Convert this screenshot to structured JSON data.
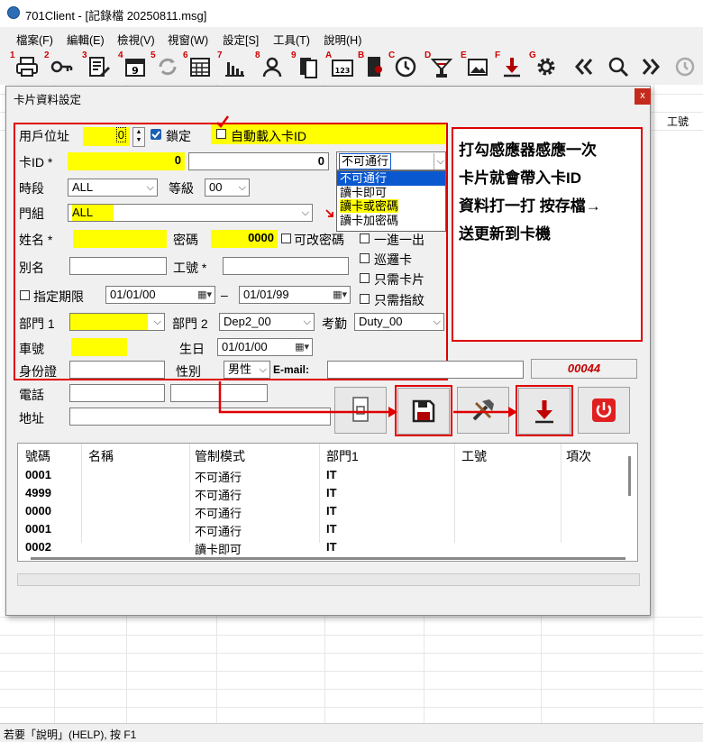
{
  "window": {
    "title": "701Client - [記錄檔 20250811.msg]"
  },
  "menu": [
    "檔案(F)",
    "編輯(E)",
    "檢視(V)",
    "視窗(W)",
    "設定[S]",
    "工具(T)",
    "說明(H)"
  ],
  "toolbar_numbers": [
    "1",
    "2",
    "3",
    "4",
    "5",
    "6",
    "7",
    "8",
    "9",
    "A",
    "B",
    "C",
    "D",
    "E",
    "F",
    "G"
  ],
  "toolbar_icon_text": {
    "calendar": "9",
    "contact_card": "123"
  },
  "background": {
    "column_header": "工號"
  },
  "dialog": {
    "title": "卡片資料設定",
    "close": "x",
    "user_address_label": "用戶位址",
    "user_address_value": "0",
    "lock_label": "鎖定",
    "auto_card_label": "自動載入卡ID",
    "card_id_label": "卡ID *",
    "card_id_value": "0",
    "card_id_value2": "0",
    "pass_mode_selected": "不可通行",
    "pass_mode_options": [
      "不可通行",
      "讀卡即可",
      "讀卡或密碼",
      "讀卡加密碼"
    ],
    "period_label": "時段",
    "period_value": "ALL",
    "level_label": "等級",
    "level_value": "00",
    "door_group_label": "門組",
    "door_group_value": "ALL",
    "name_label": "姓名 *",
    "password_label": "密碼",
    "password_value": "0000",
    "can_change_pw_label": "可改密碼",
    "one_in_one_out_label": "一進一出",
    "patrol_card_label": "巡邏卡",
    "card_only_label": "只需卡片",
    "fingerprint_only_label": "只需指紋",
    "alias_label": "別名",
    "employee_no_label": "工號 *",
    "expiry_label": "指定期限",
    "date_from": "01/01/00",
    "date_sep": "–",
    "date_to": "01/01/99",
    "dept1_label": "部門 1",
    "dept2_label": "部門 2",
    "dept2_value": "Dep2_00",
    "attendance_label": "考勤",
    "attendance_value": "Duty_00",
    "plate_label": "車號",
    "birthday_label": "生日",
    "birthday_value": "01/01/00",
    "id_label": "身份證",
    "gender_label": "性別",
    "gender_value": "男性",
    "email_label": "E-mail:",
    "counter_value": "00044",
    "phone_label": "電話",
    "address_label": "地址"
  },
  "table": {
    "headers": [
      "號碼",
      "名稱",
      "管制模式",
      "部門1",
      "工號",
      "項次"
    ],
    "rows": [
      [
        "0001",
        "",
        "不可通行",
        "IT"
      ],
      [
        "4999",
        "",
        "不可通行",
        "IT"
      ],
      [
        "0000",
        "",
        "不可通行",
        "IT"
      ],
      [
        "0001",
        "",
        "不可通行",
        "IT"
      ],
      [
        "0002",
        "",
        "讀卡即可",
        "IT"
      ]
    ]
  },
  "callout": {
    "lines": [
      "打勾感應器感應一次",
      "卡片就會帶入卡ID",
      "資料打一打 按存檔→",
      "送更新到卡機"
    ]
  },
  "status": "若要「說明」(HELP), 按 F1",
  "colors": {
    "highlight": "#ffff00",
    "annotation_red": "#e00000",
    "selection_blue": "#0a58d0"
  }
}
